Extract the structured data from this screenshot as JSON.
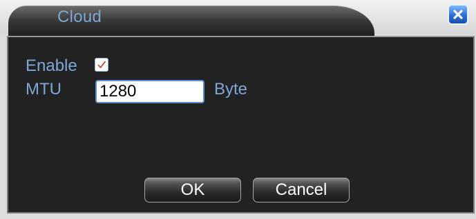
{
  "dialog": {
    "title": "Cloud"
  },
  "form": {
    "enable_label": "Enable",
    "enable_checked": true,
    "mtu_label": "MTU",
    "mtu_value": "1280",
    "mtu_unit": "Byte"
  },
  "buttons": {
    "ok_label": "OK",
    "cancel_label": "Cancel"
  },
  "icons": {
    "close": "close-icon",
    "check": "checkmark-icon"
  },
  "colors": {
    "label_text": "#7fa6d8",
    "panel_bg": "#222222",
    "close_button": "#2c6fd6",
    "checkmark": "#c0392b"
  }
}
